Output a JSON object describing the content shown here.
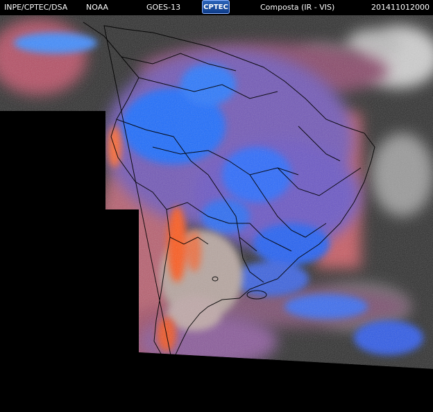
{
  "header": {
    "org": "INPE/CPTEC/DSA",
    "agency": "NOAA",
    "satellite": "GOES-13",
    "logo": "CPTEC",
    "product": "Composta (IR - VIS)",
    "timestamp": "201411012000"
  },
  "colors": {
    "background": "#000000",
    "deep_convection": "#1e6cff",
    "mid_cloud": "#7f5fd0",
    "low_warm": "#c85a63",
    "hot_surface": "#ff5a1e",
    "ocean_dark": "#2f2f2f",
    "ir_white": "#d8d8d8",
    "border_lines": "#000000"
  }
}
